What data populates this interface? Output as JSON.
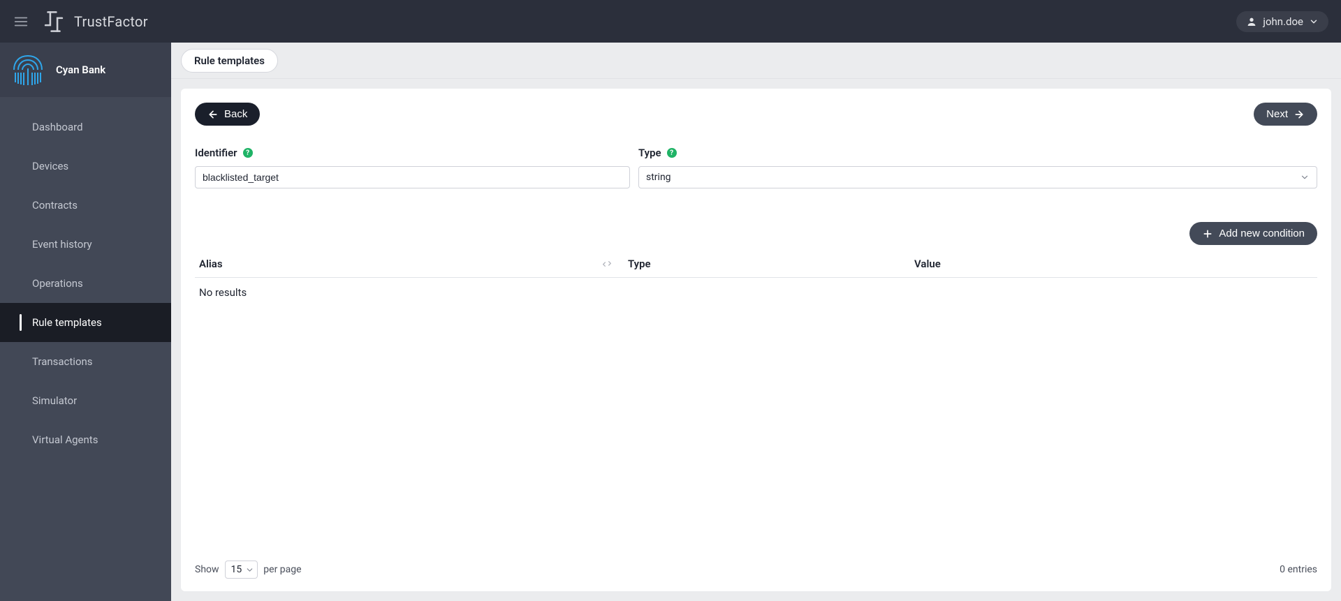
{
  "header": {
    "app_title": "TrustFactor",
    "user": "john.doe"
  },
  "org": {
    "name": "Cyan Bank"
  },
  "sidebar": {
    "items": [
      {
        "label": "Dashboard"
      },
      {
        "label": "Devices"
      },
      {
        "label": "Contracts"
      },
      {
        "label": "Event history"
      },
      {
        "label": "Operations"
      },
      {
        "label": "Rule templates"
      },
      {
        "label": "Transactions"
      },
      {
        "label": "Simulator"
      },
      {
        "label": "Virtual Agents"
      }
    ],
    "active_index": 5
  },
  "breadcrumb": {
    "label": "Rule templates"
  },
  "wizard": {
    "back_label": "Back",
    "next_label": "Next"
  },
  "form": {
    "identifier_label": "Identifier",
    "identifier_value": "blacklisted_target",
    "type_label": "Type",
    "type_value": "string"
  },
  "conditions": {
    "add_label": "Add new condition",
    "columns": {
      "alias": "Alias",
      "type": "Type",
      "value": "Value"
    },
    "empty_text": "No results"
  },
  "pager": {
    "show_label": "Show",
    "per_page_label": "per page",
    "page_size": "15",
    "entries_text": "0 entries"
  }
}
